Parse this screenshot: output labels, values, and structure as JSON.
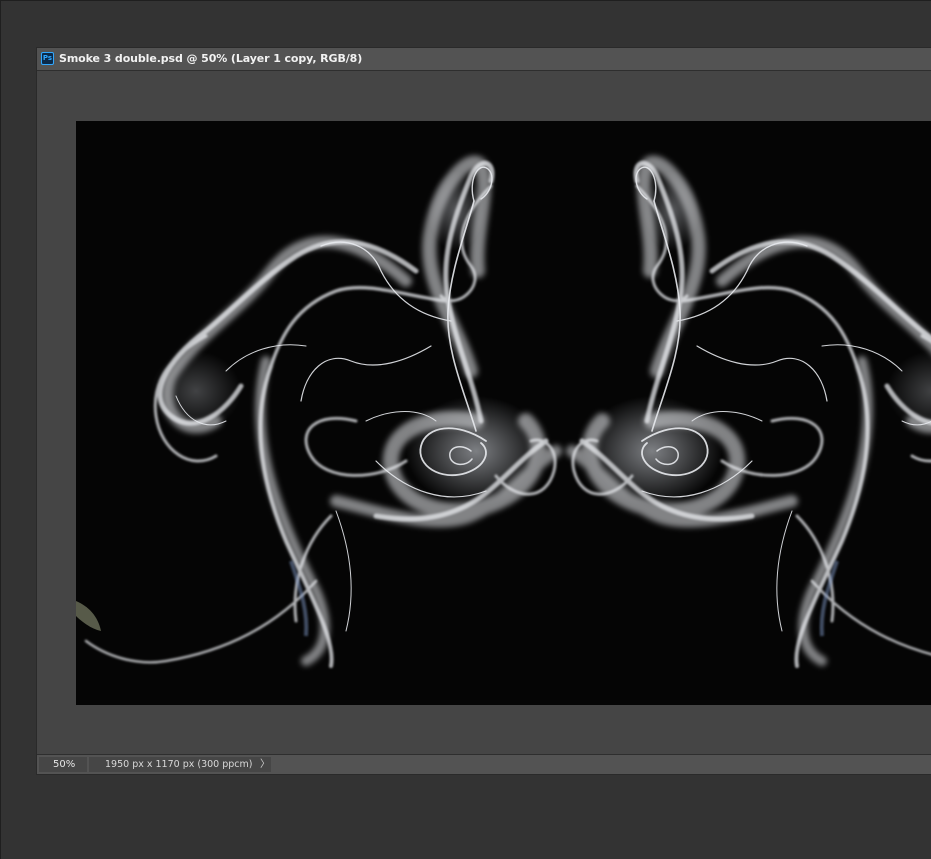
{
  "document": {
    "app_icon_label": "Ps",
    "title": "Smoke 3 double.psd @ 50% (Layer 1 copy, RGB/8)"
  },
  "statusbar": {
    "zoom": "50%",
    "doc_info": "1950 px x 1170 px (300 ppcm)",
    "info_arrow": "〉"
  },
  "canvas": {
    "subject": "mirrored-white-smoke-on-black",
    "background_color": "#050505",
    "smoke_color": "#e8eaee"
  },
  "colors": {
    "workspace": "#333333",
    "window_frame": "#494949",
    "titlebar": "#535353",
    "ps_icon_accent": "#31a8ff"
  }
}
